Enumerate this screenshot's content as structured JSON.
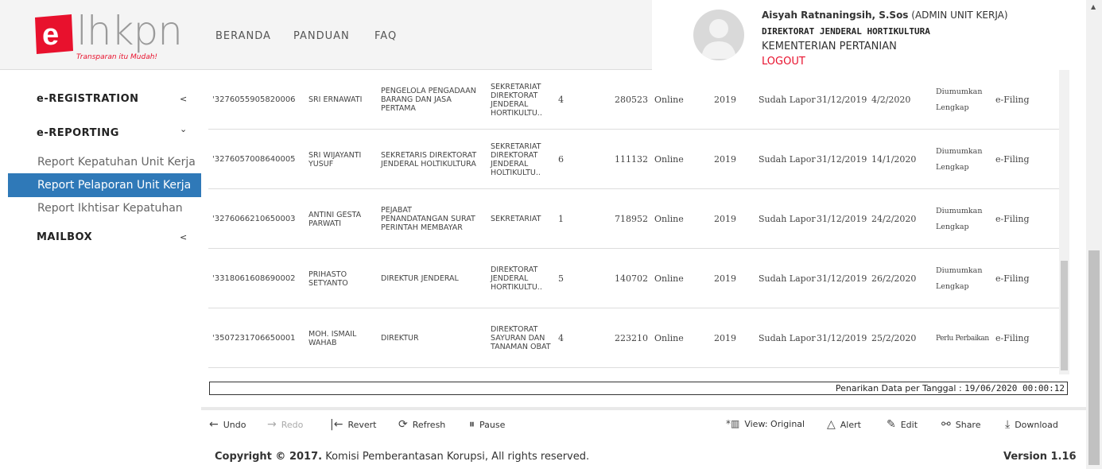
{
  "logo": {
    "text": "lhkpn",
    "mark": "e",
    "tagline": "Transparan itu Mudah!"
  },
  "nav": {
    "items": [
      "BERANDA",
      "PANDUAN",
      "FAQ"
    ]
  },
  "user": {
    "name": "Aisyah Ratnaningsih, S.Sos",
    "role": "(ADMIN UNIT KERJA)",
    "dept": "DIREKTORAT JENDERAL HORTIKULTURA",
    "org": "KEMENTERIAN PERTANIAN",
    "logout": "LOGOUT"
  },
  "sidebar": {
    "registration": "e-REGISTRATION",
    "reporting": "e-REPORTING",
    "sub": [
      "Report Kepatuhan Unit Kerja",
      "Report Pelaporan Unit Kerja",
      "Report Ikhtisar Kepatuhan"
    ],
    "mailbox": "MAILBOX",
    "caret_left": "<",
    "caret_down": "⌄"
  },
  "rows": [
    {
      "nik": "'3276055905820006",
      "nama": "SRI ERNAWATI",
      "jabatan": "PENGELOLA PENGADAAN BARANG DAN JASA PERTAMA",
      "unit": "SEKRETARIAT DIREKTORAT JENDERAL HORTIKULTU..",
      "n": "4",
      "id": "280523",
      "mode": "Online",
      "tahun": "2019",
      "status": "Sudah Lapor",
      "tgl_lapor": "31/12/2019",
      "tgl_kirim": "4/2/2020",
      "pengumuman": "Diumumkan Lengkap",
      "via": "e-Filing"
    },
    {
      "nik": "'3276057008640005",
      "nama": "SRI WIJAYANTI YUSUF",
      "jabatan": "SEKRETARIS DIREKTORAT JENDERAL HOLTIKULTURA",
      "unit": "SEKRETARIAT DIREKTORAT JENDERAL HOLTIKULTU..",
      "n": "6",
      "id": "111132",
      "mode": "Online",
      "tahun": "2019",
      "status": "Sudah Lapor",
      "tgl_lapor": "31/12/2019",
      "tgl_kirim": "14/1/2020",
      "pengumuman": "Diumumkan Lengkap",
      "via": "e-Filing"
    },
    {
      "nik": "'3276066210650003",
      "nama": "ANTINI GESTA PARWATI",
      "jabatan": "PEJABAT PENANDATANGAN SURAT PERINTAH MEMBAYAR",
      "unit": "SEKRETARIAT",
      "n": "1",
      "id": "718952",
      "mode": "Online",
      "tahun": "2019",
      "status": "Sudah Lapor",
      "tgl_lapor": "31/12/2019",
      "tgl_kirim": "24/2/2020",
      "pengumuman": "Diumumkan Lengkap",
      "via": "e-Filing"
    },
    {
      "nik": "'3318061608690002",
      "nama": "PRIHASTO SETYANTO",
      "jabatan": "DIREKTUR JENDERAL",
      "unit": "DIREKTORAT JENDERAL HORTIKULTU..",
      "n": "5",
      "id": "140702",
      "mode": "Online",
      "tahun": "2019",
      "status": "Sudah Lapor",
      "tgl_lapor": "31/12/2019",
      "tgl_kirim": "26/2/2020",
      "pengumuman": "Diumumkan Lengkap",
      "via": "e-Filing"
    },
    {
      "nik": "'3507231706650001",
      "nama": "MOH. ISMAIL WAHAB",
      "jabatan": "DIREKTUR",
      "unit": "DIREKTORAT SAYURAN DAN TANAMAN OBAT",
      "n": "4",
      "id": "223210",
      "mode": "Online",
      "tahun": "2019",
      "status": "Sudah Lapor",
      "tgl_lapor": "31/12/2019",
      "tgl_kirim": "25/2/2020",
      "pengumuman": "Perlu Perbaikan",
      "via": "e-Filing"
    }
  ],
  "penarikan": {
    "label": "Penarikan Data per Tanggal :",
    "value": "19/06/2020 00:00:12"
  },
  "toolbar": {
    "undo": "Undo",
    "redo": "Redo",
    "revert": "Revert",
    "refresh": "Refresh",
    "pause": "Pause",
    "view": "View: Original",
    "alert": "Alert",
    "edit": "Edit",
    "share": "Share",
    "download": "Download"
  },
  "footer": {
    "copyright": "Copyright © 2017.",
    "text": "Komisi Pemberantasan Korupsi, All rights reserved.",
    "version": "Version 1.16"
  },
  "colors": {
    "brand_red": "#e8112d",
    "active_blue": "#2f79b8"
  }
}
